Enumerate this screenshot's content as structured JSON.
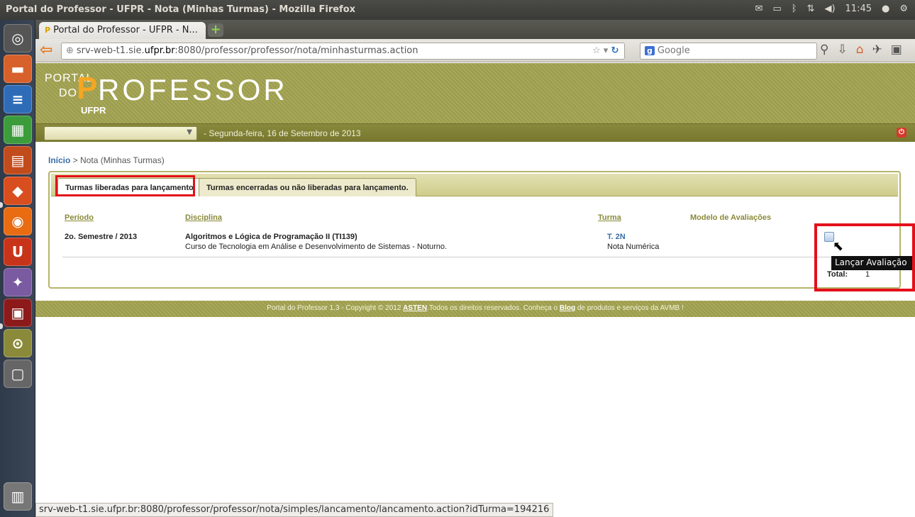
{
  "top_panel": {
    "window_title": "Portal do Professor - UFPR - Nota (Minhas Turmas) - Mozilla Firefox",
    "clock": "11:45",
    "indicators": [
      "mail-icon",
      "battery-icon",
      "bluetooth-icon",
      "network-icon",
      "volume-icon",
      "user-icon",
      "gear-icon"
    ]
  },
  "browser": {
    "tab_title": "Portal do Professor - UFPR - N...",
    "url_prefix": "srv-web-t1.sie.",
    "url_domain": "ufpr.br",
    "url_suffix": ":8080/professor/professor/nota/minhasturmas.action",
    "search_placeholder": "Google",
    "status_url": "srv-web-t1.sie.ufpr.br:8080/professor/professor/nota/simples/lancamento/lancamento.action?idTurma=194216"
  },
  "header": {
    "logo_portal": "PORTAL",
    "logo_do": "DO",
    "logo_p": "P",
    "logo_rest": "ROFESSOR",
    "logo_org": "UFPR",
    "select_value": "",
    "date": "Segunda-feira, 16 de Setembro de 2013"
  },
  "breadcrumb": {
    "home": "Início",
    "current": " > Nota (Minhas Turmas)"
  },
  "tabs": {
    "liberadas": "Turmas liberadas para lançamento.",
    "encerradas": "Turmas encerradas ou não liberadas para lançamento."
  },
  "table": {
    "headers": {
      "periodo": "Período",
      "disciplina": "Disciplina",
      "turma": "Turma",
      "modelo": "Modelo de Avaliações"
    },
    "rows": [
      {
        "periodo": "2o. Semestre / 2013",
        "disciplina": "Algoritmos e Lógica de Programação II (TI139)",
        "curso": "Curso de Tecnologia em Análise e Desenvolvimento de Sistemas - Noturno.",
        "turma": "T. 2N",
        "tipo_nota": "Nota Numérica"
      }
    ],
    "total_label": "Total:",
    "total_value": "1"
  },
  "tooltip": "Lançar Avaliação",
  "footer": {
    "text_before": "Portal do Professor 1.3 - Copyright © 2012 ",
    "asten": "ASTEN",
    "text_middle": ".Todos os direitos reservados. Conheça o ",
    "blog": "Blog",
    "text_after": " de produtos e serviços da AVMB !"
  },
  "colors": {
    "banner": "#a8a85a",
    "subbar": "#80803a",
    "highlight": "#e3101a",
    "link": "#3a6ea5"
  }
}
